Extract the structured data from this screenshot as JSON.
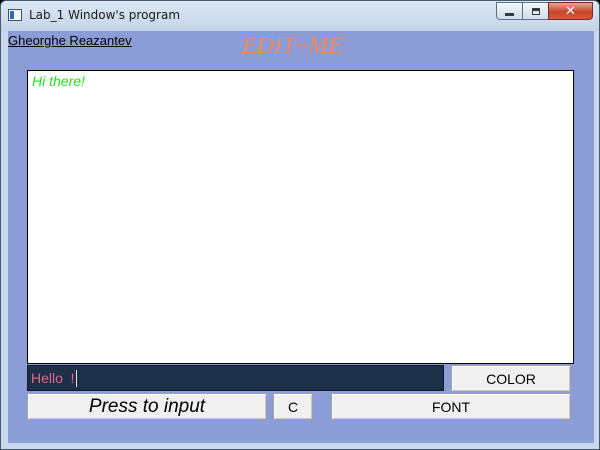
{
  "window": {
    "title": "Lab_1 Window's program",
    "controls": {
      "minimize": "minimize-icon",
      "maximize": "maximize-icon",
      "close": "close-icon",
      "close_glyph": "✕"
    }
  },
  "header": {
    "author_link": "Gheorghe Reazantev",
    "heading": "EDIT~ME"
  },
  "editor": {
    "text": "Hi there!",
    "text_color": "#22e022"
  },
  "input": {
    "value": "Hello  !",
    "text_color": "#e06a8c",
    "background": "#1d3048"
  },
  "buttons": {
    "color_label": "COLOR",
    "press_label": "Press to input",
    "c_label": "C",
    "font_label": "FONT"
  },
  "colors": {
    "client_background": "#8b9cd6",
    "heading_color": "#f08a5a"
  }
}
